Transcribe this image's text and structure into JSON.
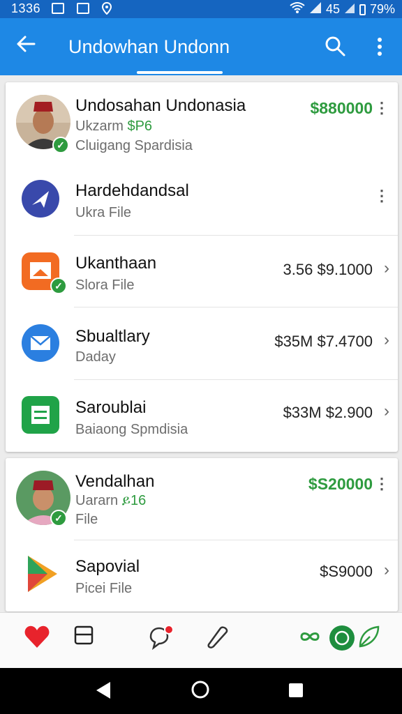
{
  "status_bar": {
    "time": "1336",
    "network": "45",
    "battery": "79%"
  },
  "app_bar": {
    "title": "Undowhan Undonn",
    "back_icon": "arrow-left-icon",
    "search_icon": "search-icon",
    "more_icon": "more-vert-icon"
  },
  "card1": {
    "rows": [
      {
        "primary": "Undosahan Undonasia",
        "secondary_prefix": "Ukzarm ",
        "secondary_green": "$P6",
        "tertiary": "Cluigang Spardisia",
        "amount": "$880000",
        "more": "⋮"
      },
      {
        "primary": "Hardehdandsal",
        "secondary": "Ukra File",
        "more": "⋮"
      },
      {
        "primary": "Ukanthaan",
        "secondary": "Slora File",
        "amount": "3.56 $9.1000",
        "chevron": "›"
      },
      {
        "primary": "Sbualtlary",
        "secondary": "Daday",
        "amount": "$35M $7.4700",
        "chevron": "›"
      },
      {
        "primary": "Saroublai",
        "secondary": "Baiaong Spmdisia",
        "amount": "$33M $2.900",
        "chevron": "›"
      }
    ]
  },
  "card2": {
    "rows": [
      {
        "primary": "Vendalhan",
        "secondary_prefix": "Uararn ",
        "secondary_green": "ይ16",
        "tertiary": "File",
        "amount": "$S20000",
        "more": "⋮"
      },
      {
        "primary": "Sapovial",
        "secondary": "Picei File",
        "amount": "$S9000",
        "chevron": "›"
      }
    ]
  },
  "colors": {
    "status_bar": "#1565c0",
    "app_bar": "#1e88e5",
    "accent_green": "#2e9b3f",
    "amount_red": "#8b1c2a"
  }
}
